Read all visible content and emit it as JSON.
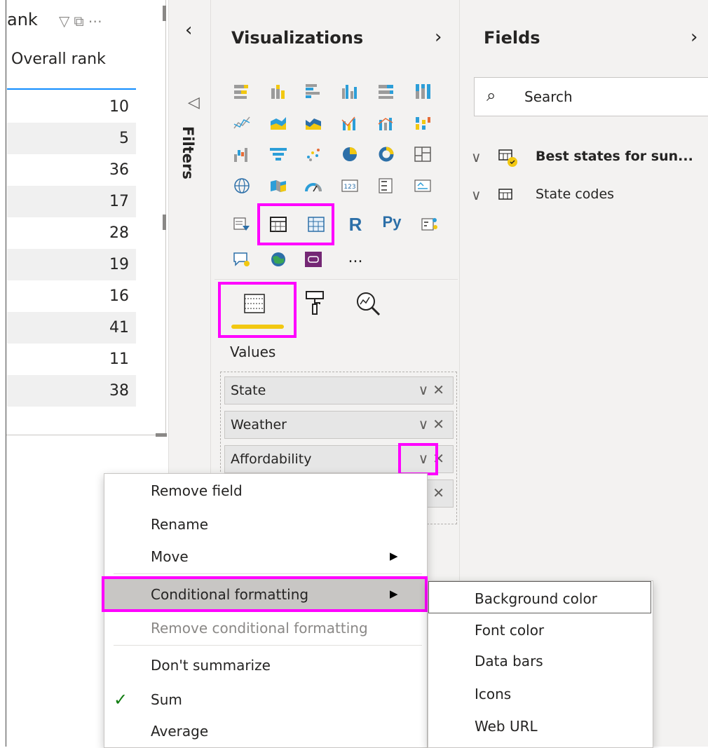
{
  "visual": {
    "title": "ank",
    "column_header": "Overall rank",
    "rows": [
      "10",
      "5",
      "36",
      "17",
      "28",
      "19",
      "16",
      "41",
      "11",
      "38"
    ],
    "header_icons": [
      "filter-icon",
      "focus-mode-icon",
      "more-options-icon"
    ]
  },
  "filters": {
    "label": "Filters",
    "collapse_icon": "chevron-left-icon",
    "funnel_icon": "filter-funnel-icon"
  },
  "visualizations": {
    "title": "Visualizations",
    "more": "...",
    "r_label": "R",
    "py_label": "Py",
    "values_label": "Values",
    "wells": [
      "State",
      "Weather",
      "Affordability"
    ],
    "highlight_color": "#ff00ff",
    "accent_underline": "#f2c811"
  },
  "fields": {
    "title": "Fields",
    "search_placeholder": "Search",
    "tables": [
      "Best states for sun...",
      "State codes"
    ]
  },
  "context_menu": {
    "items": {
      "remove_field": "Remove field",
      "rename": "Rename",
      "move": "Move",
      "conditional_formatting": "Conditional formatting",
      "remove_conditional_formatting": "Remove conditional formatting",
      "dont_summarize": "Don't summarize",
      "sum": "Sum",
      "average": "Average"
    },
    "checked_item": "Sum"
  },
  "submenu": {
    "items": [
      "Background color",
      "Font color",
      "Data bars",
      "Icons",
      "Web URL"
    ]
  }
}
